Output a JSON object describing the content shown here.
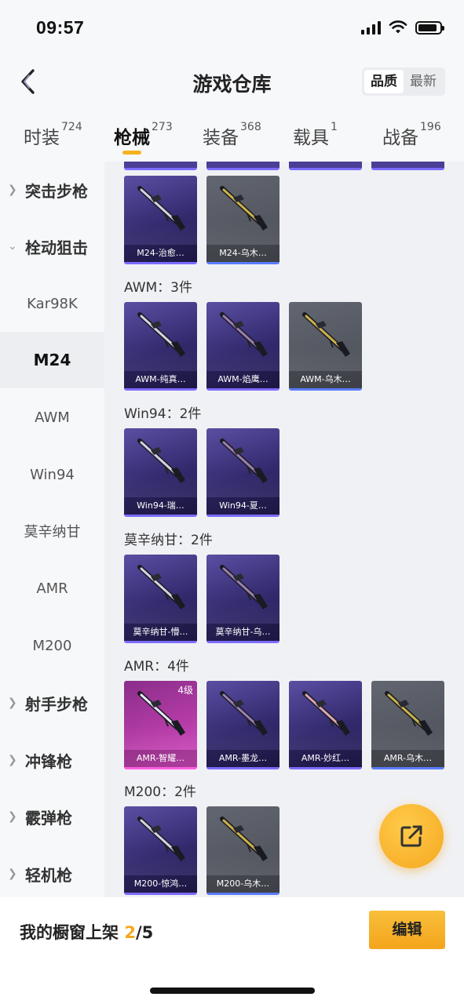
{
  "status_bar": {
    "time": "09:57"
  },
  "header": {
    "title": "游戏仓库",
    "sort_options": [
      "品质",
      "最新"
    ],
    "sort_active": "品质"
  },
  "tabs": [
    {
      "label": "时装",
      "count": "724"
    },
    {
      "label": "枪械",
      "count": "273"
    },
    {
      "label": "装备",
      "count": "368"
    },
    {
      "label": "载具",
      "count": "1"
    },
    {
      "label": "战备",
      "count": "196"
    }
  ],
  "active_tab": "枪械",
  "sidebar": {
    "items": [
      {
        "label": "突击步枪",
        "type": "category",
        "expanded": false
      },
      {
        "label": "栓动狙击",
        "type": "category",
        "expanded": true
      },
      {
        "label": "Kar98K",
        "type": "sub"
      },
      {
        "label": "M24",
        "type": "sub",
        "selected": true
      },
      {
        "label": "AWM",
        "type": "sub"
      },
      {
        "label": "Win94",
        "type": "sub"
      },
      {
        "label": "莫辛纳甘",
        "type": "sub"
      },
      {
        "label": "AMR",
        "type": "sub"
      },
      {
        "label": "M200",
        "type": "sub"
      },
      {
        "label": "射手步枪",
        "type": "category",
        "expanded": false
      },
      {
        "label": "冲锋枪",
        "type": "category",
        "expanded": false
      },
      {
        "label": "霰弹枪",
        "type": "category",
        "expanded": false
      },
      {
        "label": "轻机枪",
        "type": "category",
        "expanded": false
      }
    ]
  },
  "sections": [
    {
      "title": "",
      "items": [
        {
          "label": "M24-治愈…",
          "rarity": "purple"
        },
        {
          "label": "M24-乌木…",
          "rarity": "gray"
        }
      ]
    },
    {
      "title": "AWM：3件",
      "items": [
        {
          "label": "AWM-纯真…",
          "rarity": "purple"
        },
        {
          "label": "AWM-焰鹰…",
          "rarity": "purple"
        },
        {
          "label": "AWM-乌木…",
          "rarity": "gray"
        }
      ]
    },
    {
      "title": "Win94：2件",
      "items": [
        {
          "label": "Win94-瑞…",
          "rarity": "purple"
        },
        {
          "label": "Win94-夏…",
          "rarity": "purple"
        }
      ]
    },
    {
      "title": "莫辛纳甘：2件",
      "items": [
        {
          "label": "莫辛纳甘-懵…",
          "rarity": "purple"
        },
        {
          "label": "莫辛纳甘-乌…",
          "rarity": "purple"
        }
      ]
    },
    {
      "title": "AMR：4件",
      "items": [
        {
          "label": "AMR-智耀…",
          "rarity": "pink",
          "level": "4级"
        },
        {
          "label": "AMR-墨龙…",
          "rarity": "purple"
        },
        {
          "label": "AMR-妙红…",
          "rarity": "purple"
        },
        {
          "label": "AMR-乌木…",
          "rarity": "gray"
        }
      ]
    },
    {
      "title": "M200：2件",
      "items": [
        {
          "label": "M200-惊鸿…",
          "rarity": "purple"
        },
        {
          "label": "M200-乌木…",
          "rarity": "gray"
        }
      ]
    }
  ],
  "bottom_bar": {
    "shelf_prefix": "我的橱窗上架 ",
    "shelf_current": "2",
    "shelf_total": "/5",
    "edit_label": "编辑"
  },
  "colors": {
    "accent": "#f5a81e",
    "purple_card": "#332a6e",
    "gray_card": "#4b4e56",
    "pink_card": "#b03aa3"
  },
  "icons": {
    "back": "chevron-left-icon",
    "share": "share-export-icon"
  }
}
